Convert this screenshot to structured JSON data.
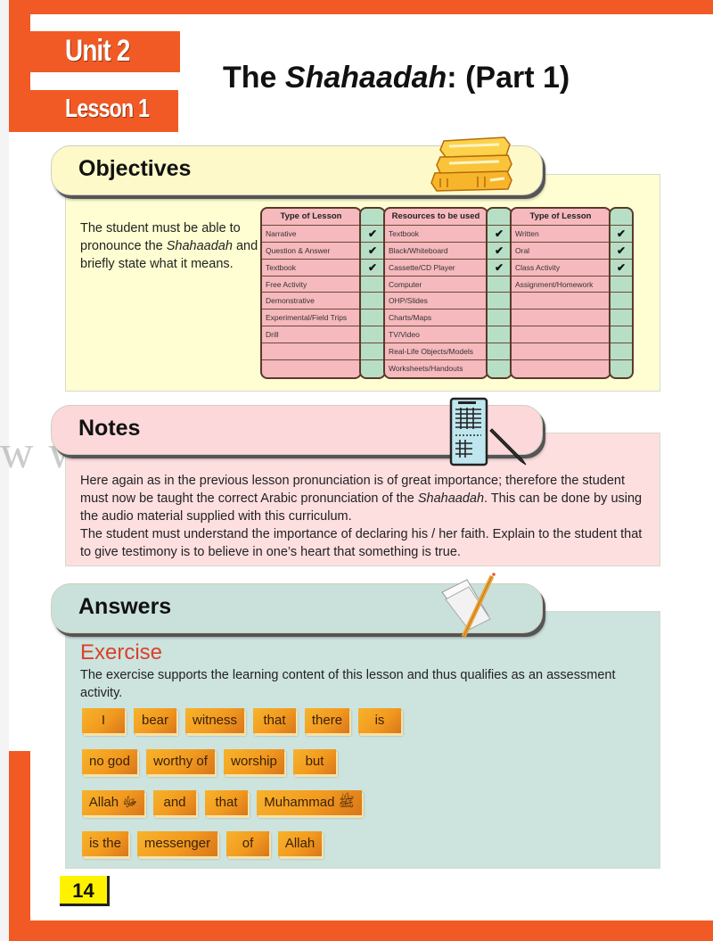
{
  "header": {
    "unit_label": "Unit 2",
    "lesson_label": "Lesson 1",
    "title_prefix": "The ",
    "title_italic": "Shahaadah",
    "title_suffix": ": (Part 1)"
  },
  "objectives": {
    "heading": "Objectives",
    "icon": "books-icon",
    "text_before": "The student must be able to pronounce the ",
    "text_italic": "Shahaadah",
    "text_after": " and briefly state what it means.",
    "tables": [
      {
        "header": "Type of Lesson",
        "rows": [
          {
            "label": "Narrative",
            "checked": true
          },
          {
            "label": "Question & Answer",
            "checked": true
          },
          {
            "label": "Textbook",
            "checked": true
          },
          {
            "label": "Free Activity",
            "checked": false
          },
          {
            "label": "Demonstrative",
            "checked": false
          },
          {
            "label": "Experimental/Field Trips",
            "checked": false
          },
          {
            "label": "Drill",
            "checked": false
          },
          {
            "label": "",
            "checked": false
          },
          {
            "label": "",
            "checked": false
          }
        ]
      },
      {
        "header": "Resources to be used",
        "rows": [
          {
            "label": "Textbook",
            "checked": true
          },
          {
            "label": "Black/Whiteboard",
            "checked": true
          },
          {
            "label": "Cassette/CD Player",
            "checked": true
          },
          {
            "label": "Computer",
            "checked": false
          },
          {
            "label": "OHP/Slides",
            "checked": false
          },
          {
            "label": "Charts/Maps",
            "checked": false
          },
          {
            "label": "TV/Video",
            "checked": false
          },
          {
            "label": "Real-Life Objects/Models",
            "checked": false
          },
          {
            "label": "Worksheets/Handouts",
            "checked": false
          }
        ]
      },
      {
        "header": "Type of Lesson",
        "rows": [
          {
            "label": "Written",
            "checked": true
          },
          {
            "label": "Oral",
            "checked": true
          },
          {
            "label": "Class Activity",
            "checked": true
          },
          {
            "label": "Assignment/Homework",
            "checked": false
          },
          {
            "label": "",
            "checked": false
          },
          {
            "label": "",
            "checked": false
          },
          {
            "label": "",
            "checked": false
          },
          {
            "label": "",
            "checked": false
          },
          {
            "label": "",
            "checked": false
          }
        ]
      }
    ],
    "check_glyph": "✔"
  },
  "notes": {
    "heading": "Notes",
    "icon": "clipboard-pen-icon",
    "p1_before": "Here again as in the previous lesson pronunciation is of great importance; therefore the student must now be taught the correct Arabic pronunciation of the ",
    "p1_italic": "Shahaadah",
    "p1_after": ". This can be done by using the audio material supplied with this curriculum.",
    "p2": "The student must understand the importance of declaring his / her faith. Explain to the student that to give testimony is to believe in one’s heart that something is true."
  },
  "watermark": "www.noorart.com",
  "answers": {
    "heading": "Answers",
    "icon": "paper-pencil-icon",
    "exercise_heading": "Exercise",
    "exercise_desc": "The exercise supports the learning content of this lesson and thus qualifies as an assessment activity.",
    "word_rows": [
      [
        "I",
        "bear",
        "witness",
        "that",
        "there",
        "is"
      ],
      [
        "no god",
        "worthy of",
        "worship",
        "but"
      ],
      [
        "Allah ﷻ",
        "and",
        "that",
        "Muhammad ﷺ"
      ],
      [
        "is the",
        "messenger",
        "of",
        "Allah"
      ]
    ]
  },
  "page_number": "14",
  "colors": {
    "frame_orange": "#f15a24",
    "objectives_bg": "#fefed2",
    "notes_bg": "#fddfe0",
    "answers_bg": "#cde3de",
    "exercise_red": "#d9412b",
    "word_tile_orange": "#f29a1f",
    "page_number_yellow": "#fff200"
  }
}
